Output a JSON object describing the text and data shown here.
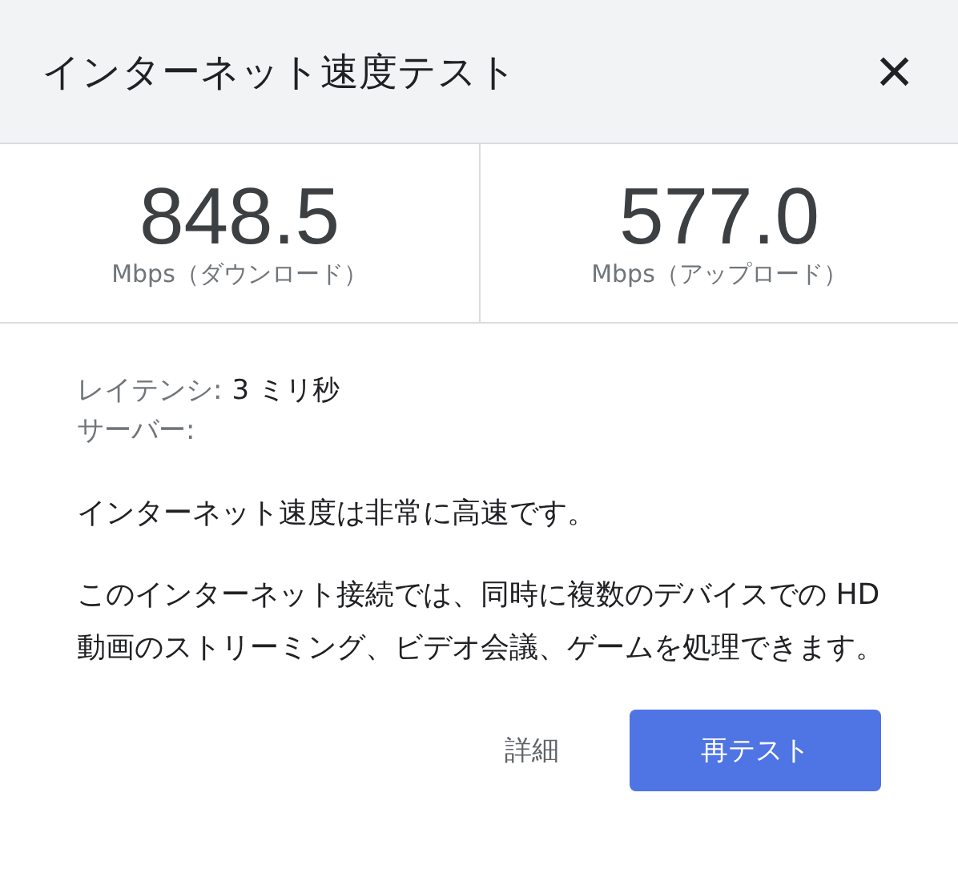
{
  "dialog": {
    "title": "インターネット速度テスト",
    "close": "×"
  },
  "results": [
    {
      "value": "848.5",
      "unit": "Mbps（ダウンロード）"
    },
    {
      "value": "577.0",
      "unit": "Mbps（アップロード）"
    }
  ],
  "latency": {
    "label": "レイテンシ:",
    "value": "3 ミリ秒"
  },
  "server": {
    "label": "サーバー:"
  },
  "verdict": "インターネット速度は非常に高速です。",
  "description": "このインターネット接続では、同時に複数のデバイスでの HD 動画のストリーミング、ビデオ会議、ゲームを処理できます。",
  "buttons": [
    {
      "label": "詳細",
      "kind": "text"
    },
    {
      "label": "再テスト",
      "kind": "primary"
    }
  ]
}
